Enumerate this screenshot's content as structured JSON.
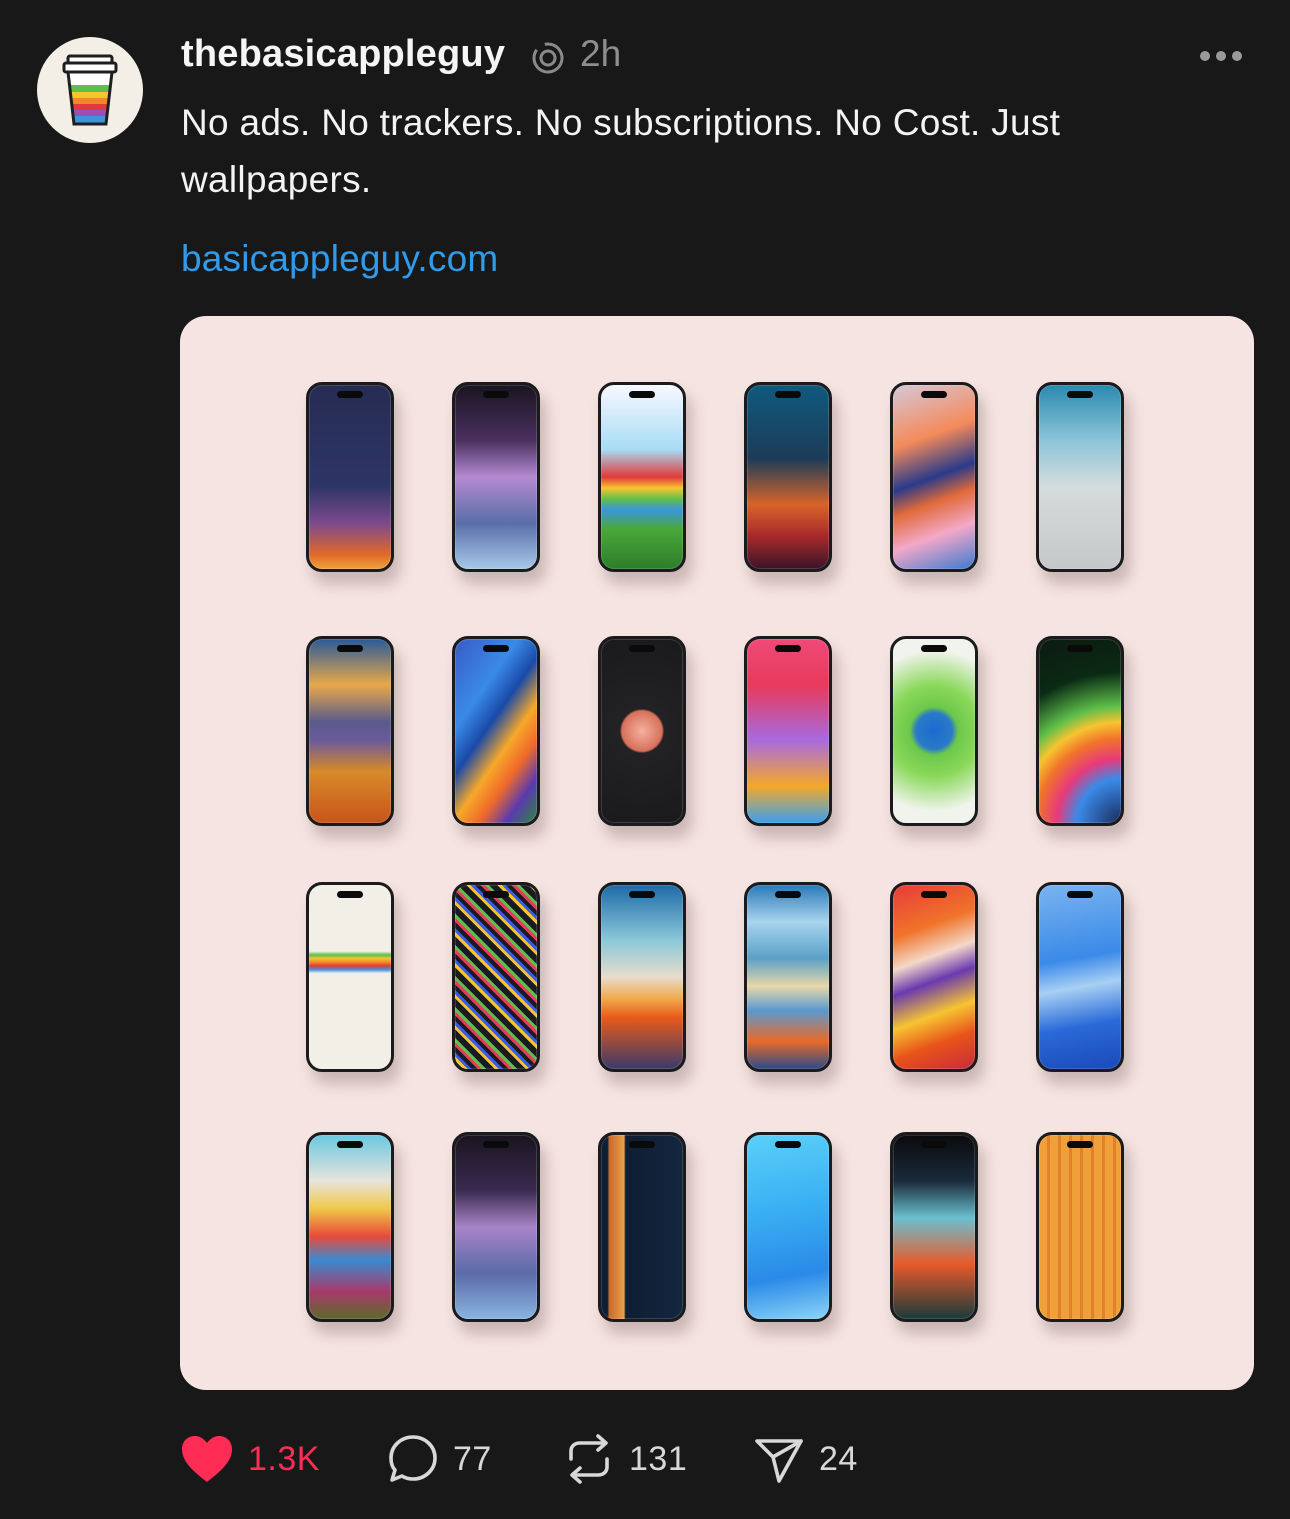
{
  "post": {
    "username": "thebasicappleguy",
    "time": "2h",
    "text": "No ads. No trackers. No subscriptions. No Cost. Just wallpapers.",
    "link": "basicappleguy.com"
  },
  "header": {
    "avatar_icon": "coffee-cup-icon",
    "badge_icon": "threads-badge-icon",
    "more_icon": "ellipsis-icon"
  },
  "actions": {
    "like_count": "1.3K",
    "reply_count": "77",
    "repost_count": "131",
    "share_count": "24"
  },
  "colors": {
    "background": "#181818",
    "link": "#2f9bea",
    "like": "#ff2d55",
    "media_background": "#f5e4e1"
  }
}
